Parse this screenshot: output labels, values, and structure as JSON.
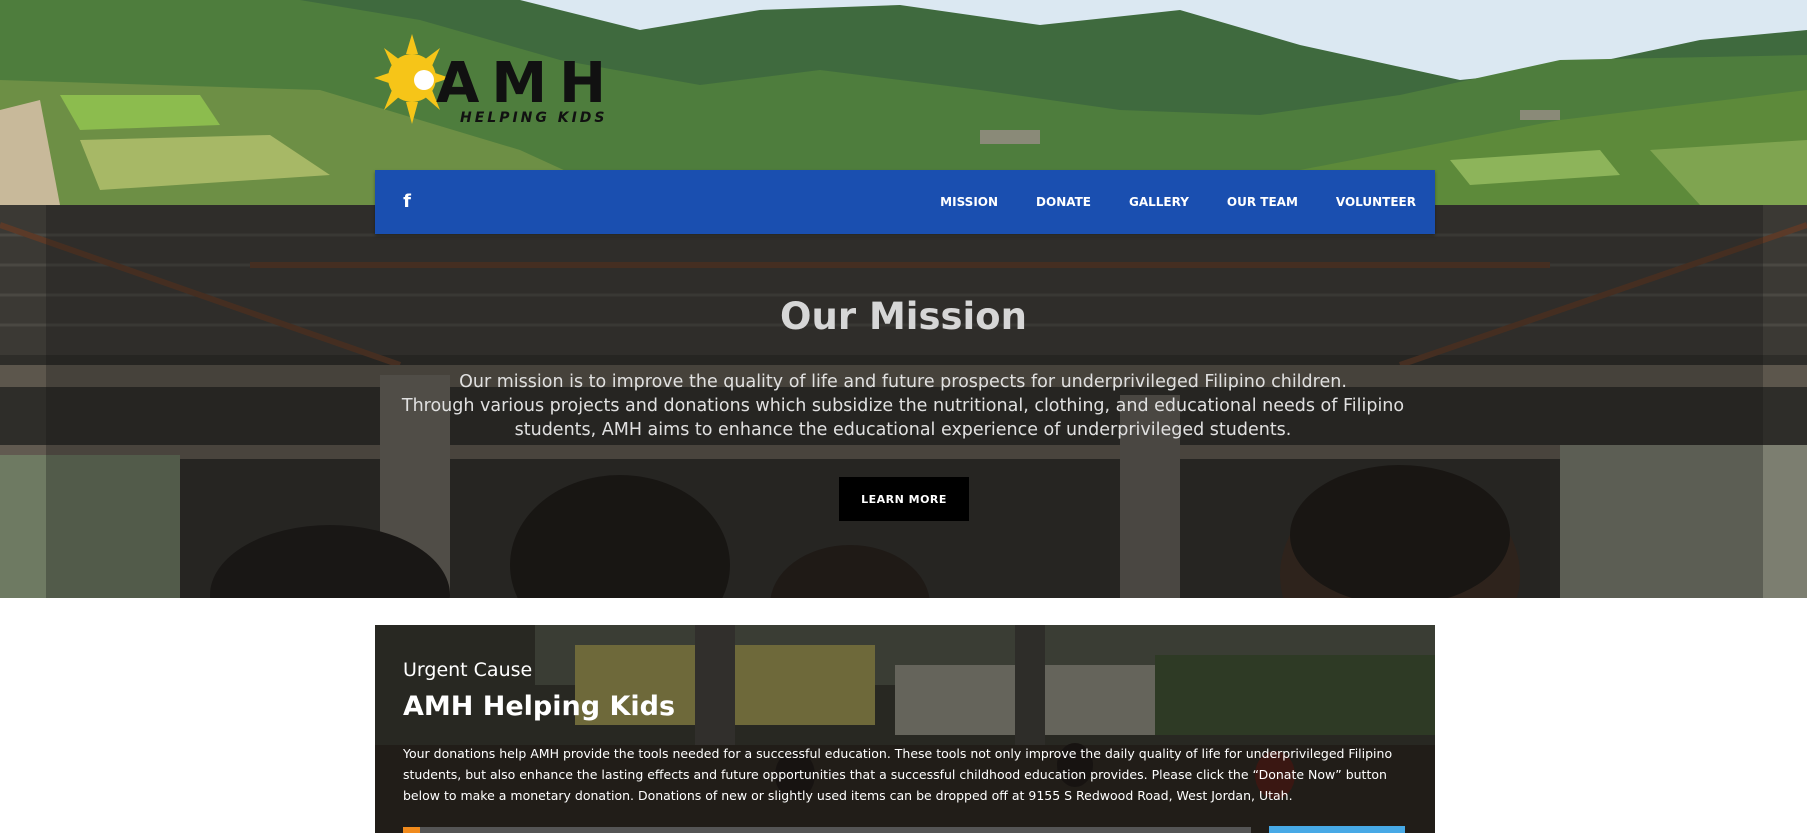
{
  "brand": {
    "logo_title": "AMH",
    "logo_subtitle": "HELPING KIDS"
  },
  "nav": {
    "facebook_label": "f",
    "items": [
      {
        "label": "MISSION"
      },
      {
        "label": "DONATE"
      },
      {
        "label": "GALLERY"
      },
      {
        "label": "OUR TEAM"
      },
      {
        "label": "VOLUNTEER"
      }
    ]
  },
  "mission": {
    "title": "Our Mission",
    "line1": "Our mission is to improve the quality of life and future prospects for underprivileged Filipino children.",
    "line2": "Through various projects and donations which subsidize the nutritional, clothing, and educational needs of Filipino students, AMH aims to enhance the educational experience of underprivileged students.",
    "button_label": "LEARN MORE"
  },
  "cause": {
    "kicker": "Urgent Cause",
    "title": "AMH Helping Kids",
    "description": "Your donations help AMH provide the tools needed for a successful education.  These tools not only improve the daily quality of life for underprivileged Filipino students, but also enhance the lasting effects and future opportunities that a successful childhood education provides.  Please click the “Donate Now” button below to make a monetary donation.  Donations of new or slightly used items can be dropped off at 9155 S Redwood Road, West Jordan, Utah.",
    "progress_fraction": 0.02
  },
  "colors": {
    "nav_bg": "#1a4fb0",
    "progress": "#f08a1c",
    "donate_button": "#47a9e6",
    "logo_sun": "#f6c518"
  }
}
